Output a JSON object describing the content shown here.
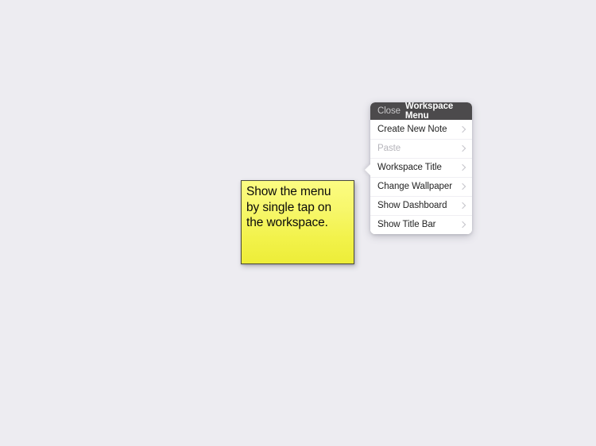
{
  "workspace": {
    "background_color": "#edecf1"
  },
  "note": {
    "text": "Show the menu\nby single tap on\nthe workspace.",
    "background_color": "#f4f44f",
    "text_color": "#0a0a0a",
    "border_color": "#4a4a3c"
  },
  "menu": {
    "close_label": "Close",
    "title": "Workspace Menu",
    "header_background": "#4c4a4c",
    "chevron_icon": "chevron-right-icon",
    "items": [
      {
        "label": "Create New Note",
        "disabled": false
      },
      {
        "label": "Paste",
        "disabled": true
      },
      {
        "label": "Workspace Title",
        "disabled": false
      },
      {
        "label": "Change Wallpaper",
        "disabled": false
      },
      {
        "label": "Show Dashboard",
        "disabled": false
      },
      {
        "label": "Show Title Bar",
        "disabled": false
      }
    ]
  }
}
